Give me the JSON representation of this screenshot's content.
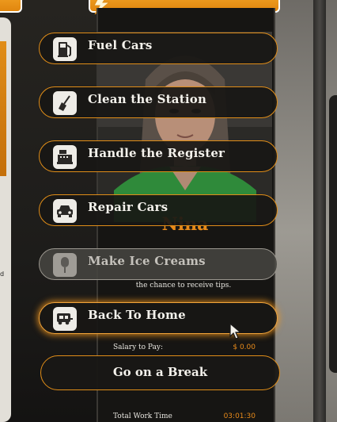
{
  "menu": {
    "items": [
      {
        "label": "Fuel Cars",
        "icon": "fuel-pump-icon",
        "state": "normal"
      },
      {
        "label": "Clean the Station",
        "icon": "broom-icon",
        "state": "normal"
      },
      {
        "label": "Handle the Register",
        "icon": "cash-register-icon",
        "state": "normal"
      },
      {
        "label": "Repair Cars",
        "icon": "car-icon",
        "state": "normal"
      },
      {
        "label": "Make Ice Creams",
        "icon": "ice-cream-icon",
        "state": "disabled"
      },
      {
        "label": "Back To Home",
        "icon": "camper-van-icon",
        "state": "hovered"
      }
    ]
  },
  "character": {
    "name_fragment": "Nina",
    "description": "the chance to receive tips."
  },
  "stats": {
    "salary_label": "Salary to Pay:",
    "salary_value": "$ 0.00",
    "total_work_label": "Total Work Time",
    "total_work_value": "03:01:30"
  },
  "break_button": {
    "label": "Go on a Break"
  },
  "background": {
    "left_text": "d"
  },
  "colors": {
    "accent": "#e08d18",
    "accent_glow": "#f2a43a",
    "button_bg": "#181715",
    "text": "#f4f2ec",
    "disabled_text": "#c4c1bb"
  }
}
